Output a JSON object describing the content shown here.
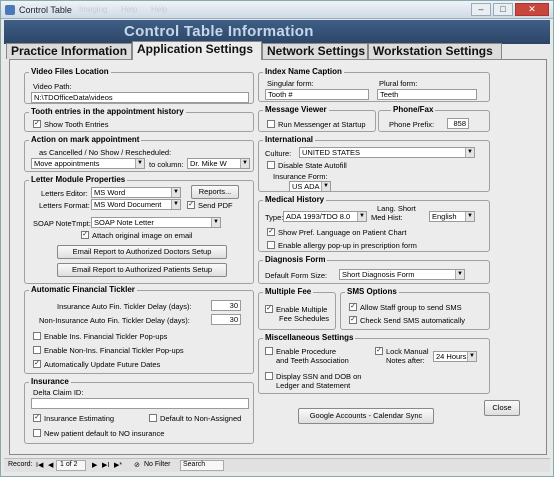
{
  "window": {
    "title": "Control Table",
    "ghost_menu": [
      "Imaging",
      "Help",
      "Help"
    ]
  },
  "header": {
    "title": "Control Table Information"
  },
  "tabs": [
    "Practice Information",
    "Application Settings",
    "Network Settings",
    "Workstation Settings"
  ],
  "video": {
    "title": "Video Files Location",
    "path_label": "Video Path:",
    "path_value": "N:\\TDOfficeData\\videos"
  },
  "tooth": {
    "title": "Tooth entries in the appointment history",
    "show_label": "Show Tooth Entries",
    "show_checked": true
  },
  "mark": {
    "title": "Action on mark appointment",
    "as_label": "as Cancelled / No Show / Rescheduled:",
    "action_value": "Move appointments",
    "to_column_label": "to column:",
    "column_value": "Dr. Mike W"
  },
  "letter": {
    "title": "Letter Module Properties",
    "editor_label": "Letters Editor:",
    "editor_value": "MS Word",
    "reports_button": "Reports...",
    "format_label": "Letters Format:",
    "format_value": "MS Word Document",
    "send_pdf_label": "Send PDF",
    "send_pdf_checked": true,
    "soap_label": "SOAP NoteTmpt:",
    "soap_value": "SOAP Note Letter",
    "attach_label": "Attach original image on email",
    "attach_checked": true,
    "email_doctors_button": "Email Report to Authorized Doctors Setup",
    "email_patients_button": "Email Report to Authorized Patients Setup"
  },
  "tickler": {
    "title": "Automatic Financial Tickler",
    "ins_delay_label": "Insurance Auto Fin. Tickler Delay (days):",
    "ins_delay_value": "30",
    "noins_delay_label": "Non-Insurance Auto Fin. Tickler Delay (days):",
    "noins_delay_value": "30",
    "enable_ins_label": "Enable Ins. Financial Tickler Pop-ups",
    "enable_ins_checked": false,
    "enable_noins_label": "Enable Non-Ins. Financial Tickler Pop-ups",
    "enable_noins_checked": false,
    "auto_update_label": "Automatically Update Future Dates",
    "auto_update_checked": true
  },
  "insurance": {
    "title": "Insurance",
    "delta_label": "Delta Claim ID:",
    "delta_value": "",
    "estimating_label": "Insurance Estimating",
    "estimating_checked": true,
    "default_nonassigned_label": "Default to Non-Assigned",
    "default_nonassigned_checked": false,
    "new_patient_label": "New patient default to NO insurance",
    "new_patient_checked": false
  },
  "index_name": {
    "title": "Index Name Caption",
    "singular_label": "Singular form:",
    "singular_value": "Tooth #",
    "plural_label": "Plural form:",
    "plural_value": "Teeth"
  },
  "messenger": {
    "title": "Message Viewer",
    "run_label": "Run Messenger at Startup",
    "run_checked": false
  },
  "phonefax": {
    "title": "Phone/Fax",
    "prefix_label": "Phone Prefix:",
    "prefix_value": "858"
  },
  "international": {
    "title": "International",
    "culture_label": "Culture:",
    "culture_value": "UNITED STATES",
    "disable_autofill_label": "Disable State Autofill",
    "disable_autofill_checked": false,
    "ins_form_label": "Insurance Form:",
    "ins_form_value": "US ADA"
  },
  "medical": {
    "title": "Medical History",
    "type_label": "Type:",
    "type_value": "ADA 1993/TDO 8.0",
    "lang_label_1": "Lang. Short",
    "lang_label_2": "Med Hist:",
    "lang_value": "English",
    "show_pref_label": "Show Pref. Language on Patient Chart",
    "show_pref_checked": true,
    "allergy_label": "Enable allergy pop-up in prescription form",
    "allergy_checked": false
  },
  "diagnosis": {
    "title": "Diagnosis Form",
    "size_label": "Default Form Size:",
    "size_value": "Short Diagnosis Form"
  },
  "multiple_fee": {
    "title": "Multiple Fee",
    "enable_label_1": "Enable Multiple",
    "enable_label_2": "Fee Schedules",
    "enable_checked": true
  },
  "sms": {
    "title": "SMS Options",
    "allow_label": "Allow Staff group to send SMS",
    "allow_checked": true,
    "check_label": "Check Send SMS automatically",
    "check_checked": true
  },
  "misc": {
    "title": "Miscellaneous Settings",
    "procedure_label_1": "Enable Procedure",
    "procedure_label_2": "and Teeth Association",
    "procedure_checked": false,
    "lock_label_1": "Lock Manual",
    "lock_label_2": "Notes after:",
    "lock_checked": true,
    "lock_value": "24 Hours",
    "ssn_label_1": "Display SSN and DOB on",
    "ssn_label_2": "Ledger and Statement",
    "ssn_checked": false
  },
  "google_button": "Google Accounts - Calendar Sync",
  "close_button": "Close",
  "statusbar": {
    "record_label": "Record:",
    "first": "I◀",
    "prev": "◀",
    "position": "1 of 2",
    "next": "▶",
    "last": "▶I",
    "new": "▶*",
    "filter": "No Filter",
    "search": "Search"
  }
}
